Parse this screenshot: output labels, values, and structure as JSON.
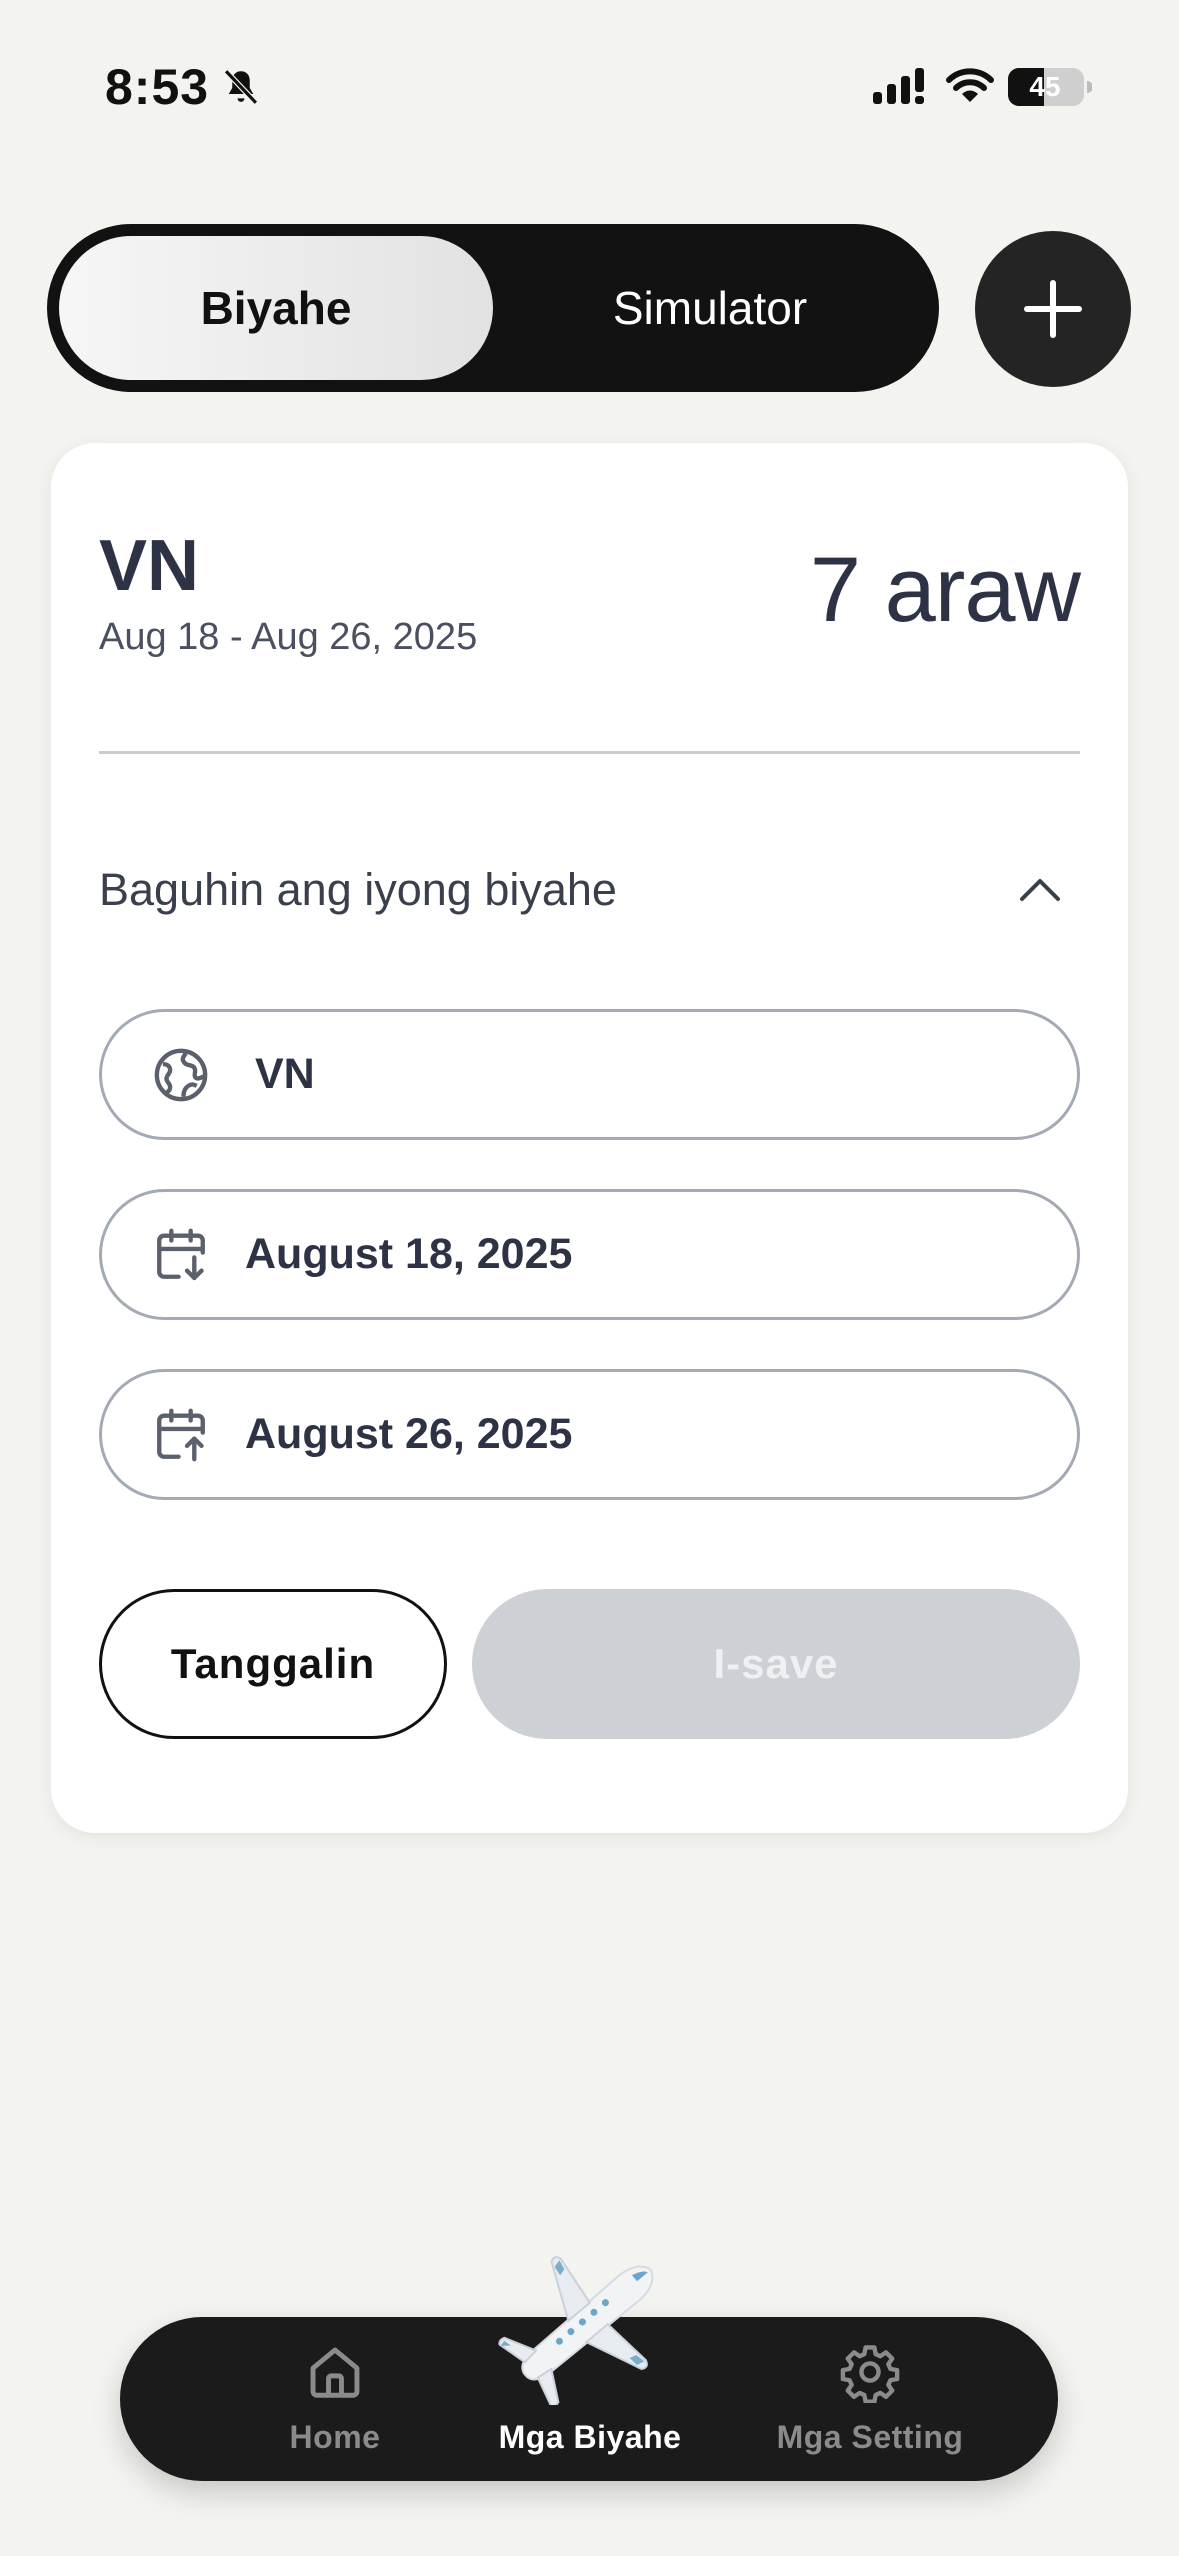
{
  "status_bar": {
    "time": "8:53",
    "battery": "45",
    "icons": [
      "bell-slash-icon",
      "signal-icon",
      "wifi-icon",
      "battery-icon"
    ]
  },
  "segmented": {
    "active": "Biyahe",
    "inactive": "Simulator"
  },
  "add_button": {
    "icon": "plus-icon"
  },
  "trip": {
    "code": "VN",
    "date_range": "Aug 18 - Aug 26, 2025",
    "duration": "7 araw"
  },
  "edit": {
    "label": "Baguhin ang iyong biyahe",
    "expanded": true,
    "country_value": "VN",
    "start_date": "August 18, 2025",
    "end_date": "August 26, 2025",
    "remove_label": "Tanggalin",
    "save_label": "I-save",
    "save_enabled": false
  },
  "nav": {
    "items": [
      {
        "label": "Home",
        "icon": "home-icon",
        "active": false
      },
      {
        "label": "Mga Biyahe",
        "icon": "airplane-icon",
        "active": true
      },
      {
        "label": "Mga Setting",
        "icon": "gear-icon",
        "active": false
      }
    ]
  },
  "colors": {
    "background": "#f3f3ef",
    "dark": "#121212",
    "text": "#2d3344",
    "field_border": "#a3aab5",
    "save_disabled": "#cdd0d4"
  }
}
